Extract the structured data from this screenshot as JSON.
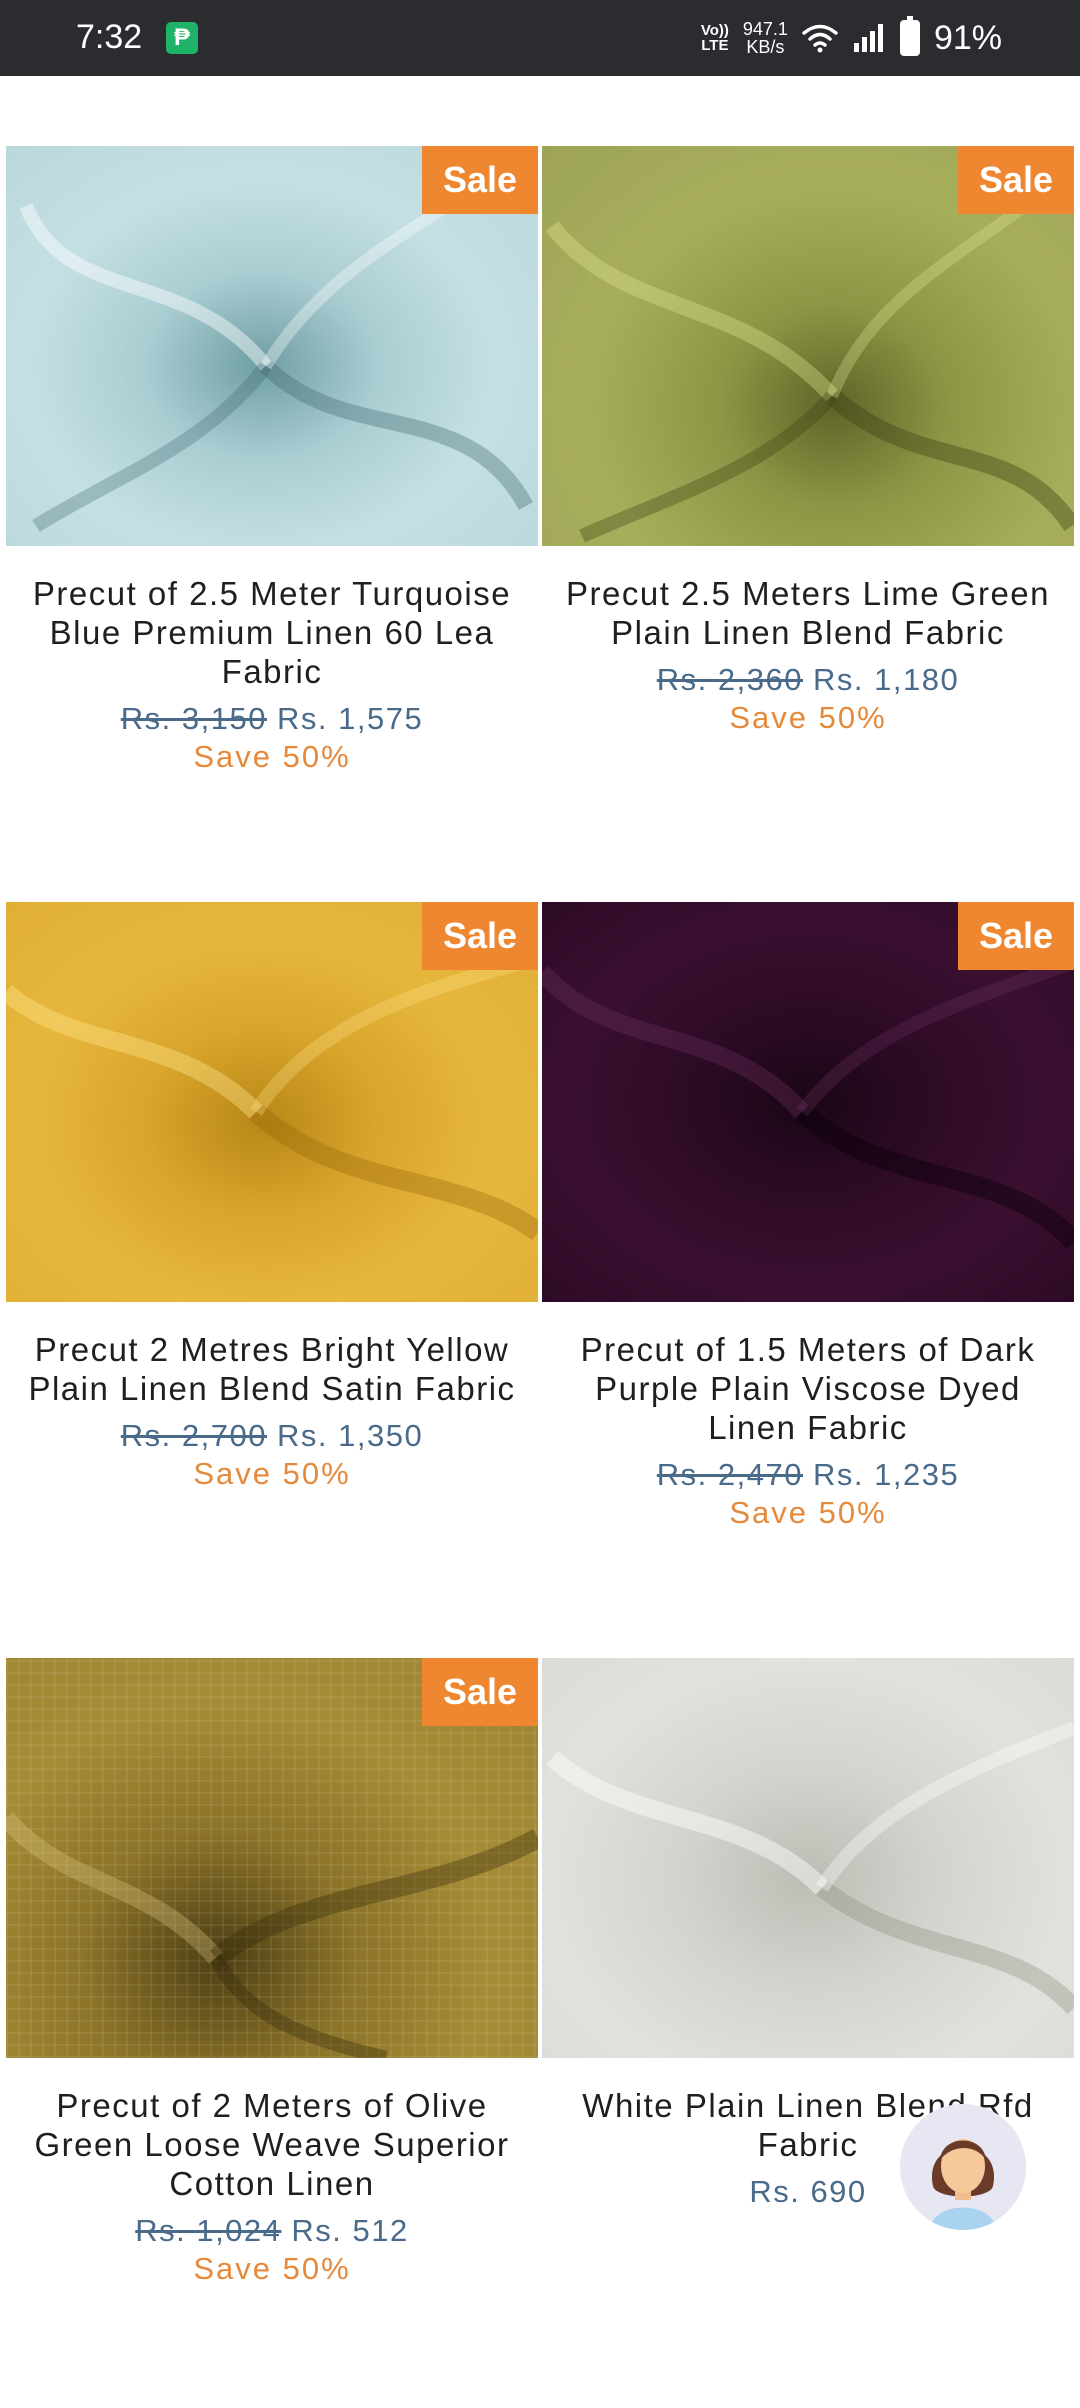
{
  "status_bar": {
    "time": "7:32",
    "volte": "VoLTE",
    "net_speed_value": "947.1",
    "net_speed_unit": "KB/s",
    "battery": "91%",
    "icons": [
      "paytm-icon",
      "wifi-icon",
      "signal-icon",
      "battery-icon"
    ]
  },
  "products": [
    {
      "title": "Precut of 2.5 Meter Turquoise Blue Premium Linen 60 Lea Fabric",
      "old_price": "Rs. 3,150",
      "price": "Rs. 1,575",
      "save": "Save 50%",
      "badge": "Sale"
    },
    {
      "title": "Precut 2.5 Meters Lime Green Plain Linen Blend Fabric",
      "old_price": "Rs. 2,360",
      "price": "Rs. 1,180",
      "save": "Save 50%",
      "badge": "Sale"
    },
    {
      "title": "Precut 2 Metres Bright Yellow Plain Linen Blend Satin Fabric",
      "old_price": "Rs. 2,700",
      "price": "Rs. 1,350",
      "save": "Save 50%",
      "badge": "Sale"
    },
    {
      "title": "Precut of 1.5 Meters of Dark Purple Plain Viscose Dyed Linen Fabric",
      "old_price": "Rs. 2,470",
      "price": "Rs. 1,235",
      "save": "Save 50%",
      "badge": "Sale"
    },
    {
      "title": "Precut of 2 Meters of Olive Green Loose Weave Superior Cotton Linen",
      "old_price": "Rs. 1,024",
      "price": "Rs. 512",
      "save": "Save 50%",
      "badge": "Sale"
    },
    {
      "title": "White Plain Linen Blend Rfd Fabric",
      "price": "Rs. 690"
    }
  ],
  "colors": {
    "sale_badge": "#ef8730",
    "price": "#4a6a8a",
    "save": "#e48a3a",
    "status_bar": "#2b2c30"
  }
}
